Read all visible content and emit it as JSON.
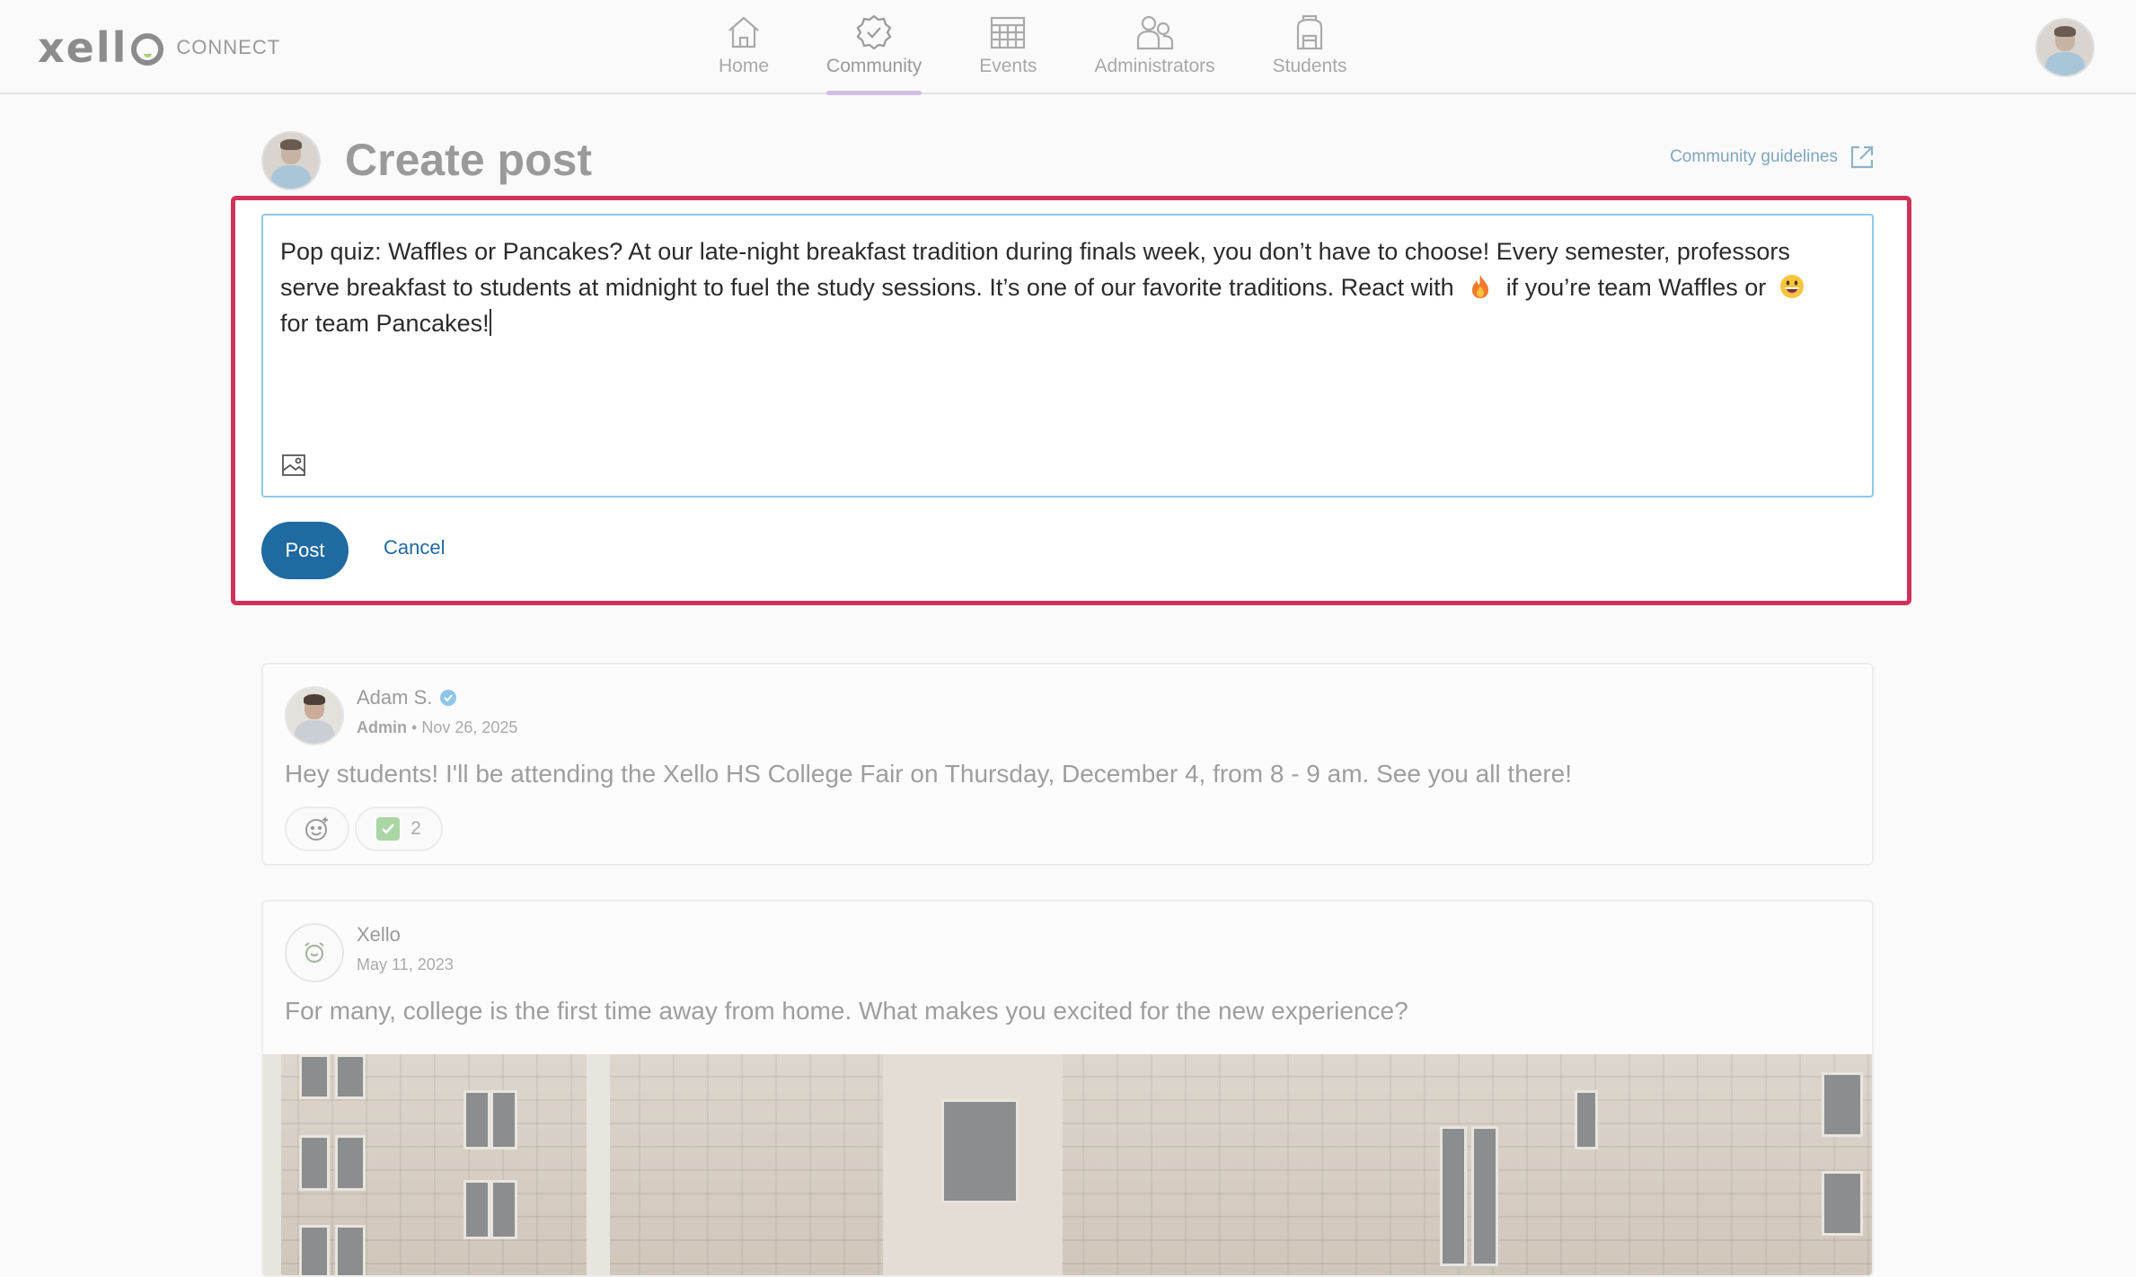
{
  "brand": {
    "wordmark": "xell",
    "sub": "CONNECT"
  },
  "nav": [
    {
      "label": "Home",
      "icon": "home-icon"
    },
    {
      "label": "Community",
      "icon": "community-badge-icon",
      "active": true
    },
    {
      "label": "Events",
      "icon": "calendar-icon"
    },
    {
      "label": "Administrators",
      "icon": "people-icon"
    },
    {
      "label": "Students",
      "icon": "backpack-icon"
    }
  ],
  "page": {
    "title": "Create post",
    "guidelines_label": "Community guidelines"
  },
  "composer": {
    "text_1": "Pop quiz: Waffles or Pancakes? At our late-night breakfast tradition during finals week, you don’t have to choose! Every semester, professors serve breakfast to students at midnight to fuel the study sessions. It’s one of our favorite traditions. React with",
    "emoji_1": "fire-emoji",
    "text_2": "if you’re team Waffles or",
    "emoji_2": "grinning-face-emoji",
    "text_3": "for team Pancakes!",
    "post_label": "Post",
    "cancel_label": "Cancel"
  },
  "feed": [
    {
      "author": "Adam S.",
      "verified": true,
      "role": "Admin",
      "sep": "•",
      "date": "Nov 26, 2025",
      "body": "Hey students! I'll be attending the Xello HS College Fair on Thursday, December 4, from 8 - 9 am. See you all there!",
      "reaction_count": "2"
    },
    {
      "author": "Xello",
      "date": "May 11, 2023",
      "body": "For many, college is the first time away from home. What makes you excited for the new experience?"
    }
  ],
  "colors": {
    "accent": "#1f6aa0",
    "highlight_border": "#d0325a",
    "nav_active_underline": "#d4bde6",
    "editor_border": "#8cc9e8"
  }
}
